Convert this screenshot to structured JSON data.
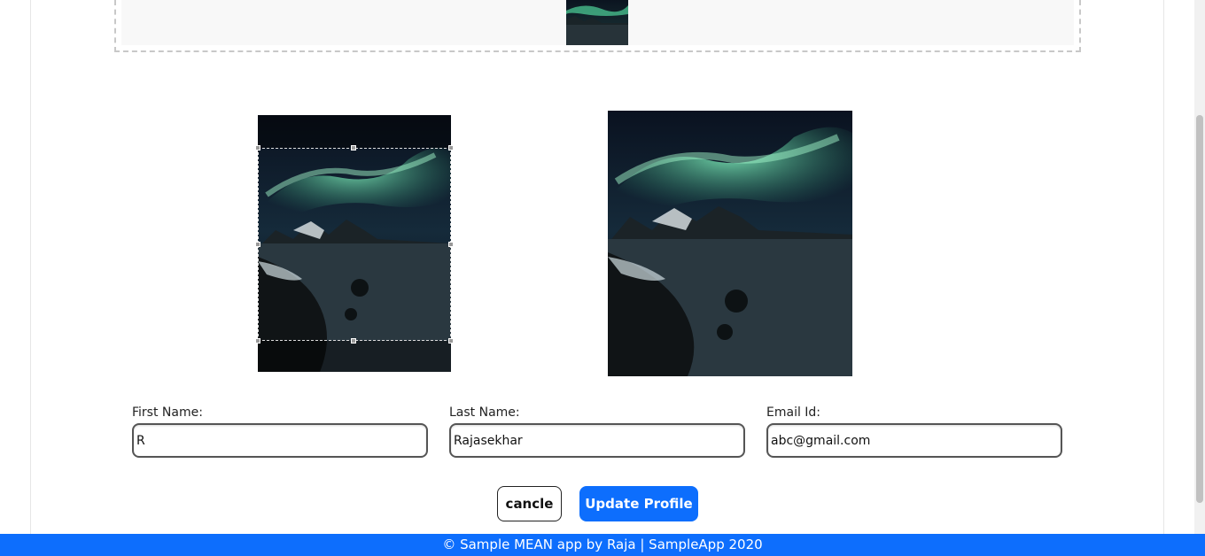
{
  "form": {
    "first_name_label": "First Name:",
    "first_name_value": "R",
    "last_name_label": "Last Name:",
    "last_name_value": "Rajasekhar",
    "email_label": "Email Id:",
    "email_value": "abc@gmail.com"
  },
  "actions": {
    "cancel_label": "cancle",
    "update_label": "Update Profile"
  },
  "footer": {
    "text": "© Sample MEAN app by Raja | SampleApp 2020"
  },
  "colors": {
    "primary": "#0d6efd",
    "aurora_green": "#4fd39a",
    "night_sky": "#0b1420"
  }
}
